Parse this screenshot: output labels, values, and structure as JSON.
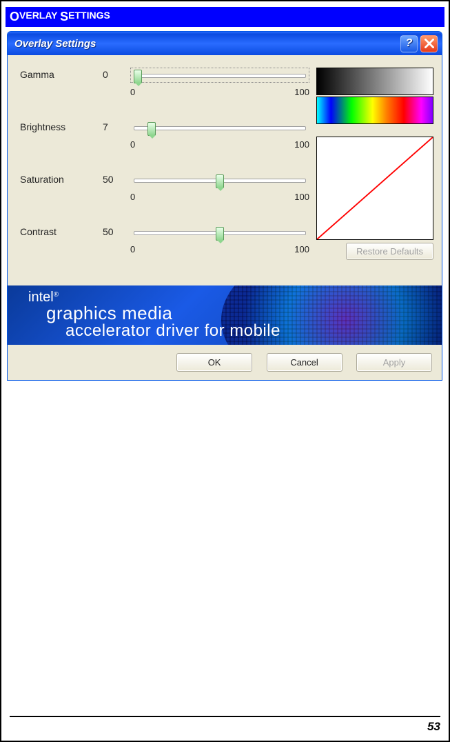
{
  "page": {
    "section_title_1": "O",
    "section_title_2": "VERLAY ",
    "section_title_3": "S",
    "section_title_4": "ETTINGS",
    "page_number": "53"
  },
  "window": {
    "title": "Overlay Settings",
    "help_label": "?",
    "sliders": {
      "gamma": {
        "label": "Gamma",
        "value": "0",
        "min": "0",
        "max": "100",
        "pos_pct": 2
      },
      "brightness": {
        "label": "Brightness",
        "value": "7",
        "min": "0",
        "max": "100",
        "pos_pct": 10
      },
      "saturation": {
        "label": "Saturation",
        "value": "50",
        "min": "0",
        "max": "100",
        "pos_pct": 50
      },
      "contrast": {
        "label": "Contrast",
        "value": "50",
        "min": "0",
        "max": "100",
        "pos_pct": 50
      }
    },
    "restore_defaults_label": "Restore Defaults",
    "banner": {
      "line1": "intel",
      "line2": "graphics media",
      "line3": "accelerator driver for mobile"
    },
    "buttons": {
      "ok": "OK",
      "cancel": "Cancel",
      "apply": "Apply"
    }
  }
}
